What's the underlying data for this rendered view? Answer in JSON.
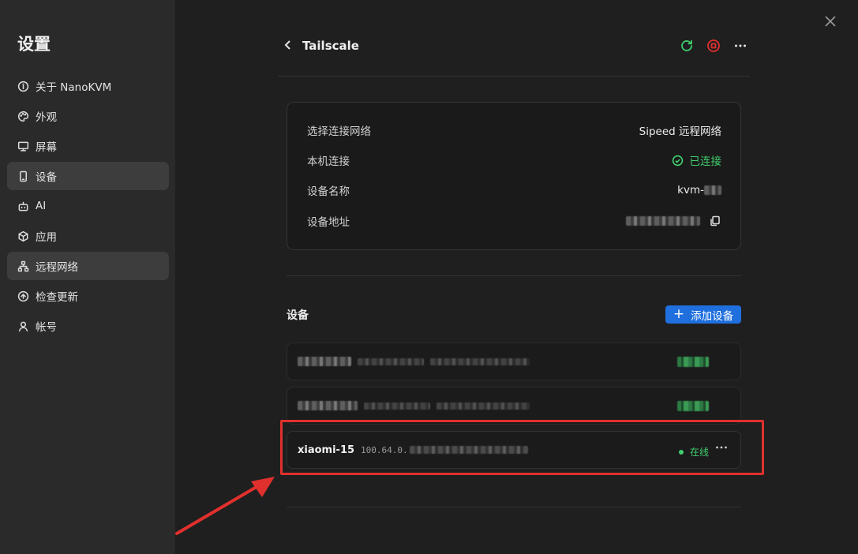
{
  "sidebar": {
    "title": "设置",
    "items": [
      {
        "label": "关于 NanoKVM",
        "icon": "info-icon",
        "active": false
      },
      {
        "label": "外观",
        "icon": "palette-icon",
        "active": false
      },
      {
        "label": "屏幕",
        "icon": "monitor-icon",
        "active": false
      },
      {
        "label": "设备",
        "icon": "phone-icon",
        "active": true
      },
      {
        "label": "AI",
        "icon": "bot-icon",
        "active": false
      },
      {
        "label": "应用",
        "icon": "box-icon",
        "active": false
      },
      {
        "label": "远程网络",
        "icon": "network-icon",
        "active": true
      },
      {
        "label": "检查更新",
        "icon": "upload-circle-icon",
        "active": false
      },
      {
        "label": "帐号",
        "icon": "user-icon",
        "active": false
      }
    ]
  },
  "header": {
    "title": "Tailscale",
    "icons": [
      "refresh-icon",
      "stop-icon",
      "more-icon"
    ]
  },
  "info": {
    "network_label": "选择连接网络",
    "network_value": "Sipeed 远程网络",
    "connection_label": "本机连接",
    "connection_value": "已连接",
    "name_label": "设备名称",
    "name_value": "kvm-",
    "address_label": "设备地址"
  },
  "devices_section": {
    "title": "设备",
    "add_label": "添加设备"
  },
  "devices": [
    {
      "name": "xiaomi-15",
      "ip": "100.64.0.",
      "status": "在线"
    }
  ],
  "colors": {
    "accent": "#1f6fde",
    "online": "#3fcf6e",
    "refresh": "#3fcf6e",
    "stop": "#e0302d",
    "highlight": "#e0302d"
  }
}
